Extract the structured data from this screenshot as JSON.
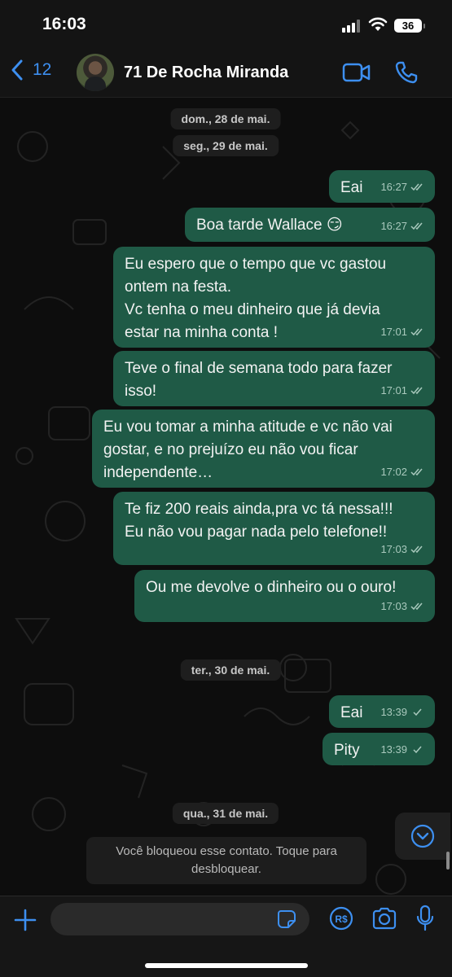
{
  "status_bar": {
    "time": "16:03",
    "battery": "36"
  },
  "header": {
    "back_count": "12",
    "contact_name": "71 De Rocha Miranda"
  },
  "colors": {
    "accent": "#3d8ff0",
    "outgoing_bubble": "#1f5a46",
    "background": "#0d0d0d"
  },
  "chat": {
    "dates": [
      "dom., 28 de mai.",
      "seg., 29 de mai.",
      "ter., 30 de mai.",
      "qua., 31 de mai."
    ],
    "messages": [
      {
        "text": "Eai",
        "time": "16:27",
        "status": "read"
      },
      {
        "text": "Boa tarde Wallace 😏",
        "time": "16:27",
        "status": "read"
      },
      {
        "text": "Eu espero que o tempo que vc gastou\nontem na festa.\nVc tenha o meu dinheiro que já devia\nestar na minha conta !",
        "time": "17:01",
        "status": "read"
      },
      {
        "text": "Teve o final de semana todo para fazer\nisso!",
        "time": "17:01",
        "status": "read"
      },
      {
        "text": "Eu vou tomar a minha atitude e vc não vai\ngostar, e no prejuízo eu não vou ficar\nindependente…",
        "time": "17:02",
        "status": "read"
      },
      {
        "text": "Te fiz 200 reais ainda,pra vc tá nessa!!!\nEu não vou pagar nada pelo telefone!!",
        "time": "17:03",
        "status": "read"
      },
      {
        "text": "Ou me devolve o dinheiro ou o ouro!",
        "time": "17:03",
        "status": "read"
      },
      {
        "text": "Eai",
        "time": "13:39",
        "status": "sent"
      },
      {
        "text": "Pity",
        "time": "13:39",
        "status": "sent"
      }
    ],
    "blocked_notice": "Você bloqueou esse contato. Toque para\ndesbloquear."
  },
  "input": {
    "placeholder": ""
  },
  "icons": [
    "back-chevron-icon",
    "video-call-icon",
    "phone-call-icon",
    "scroll-down-icon",
    "plus-icon",
    "sticker-icon",
    "payment-icon",
    "camera-icon",
    "microphone-icon"
  ]
}
